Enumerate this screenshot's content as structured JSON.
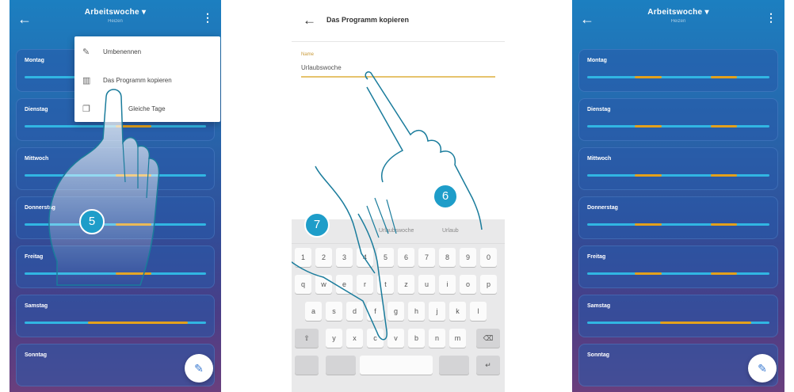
{
  "colors": {
    "accent": "#1e9dc9",
    "bar": "#31b6e3",
    "segment": "#e3a11c"
  },
  "phone1": {
    "appbar": {
      "title": "Arbeitswoche ▾",
      "subtitle": "Heizen"
    },
    "menu": [
      {
        "icon": "pencil-icon",
        "label": "Umbenennen"
      },
      {
        "icon": "copy-program-icon",
        "label": "Das Programm kopieren"
      },
      {
        "icon": "copy-days-icon",
        "label": "Gleiche Tage"
      }
    ],
    "days": [
      "Montag",
      "Dienstag",
      "Mittwoch",
      "Donnerstag",
      "Freitag",
      "Samstag",
      "Sonntag"
    ],
    "step": "5"
  },
  "phone2": {
    "title": "Das Programm kopieren",
    "field_label": "Name",
    "field_value": "Urlaubswoche",
    "suggestions": [
      "Urlaubswoche",
      "Urlaub"
    ],
    "number_row": [
      "1",
      "2",
      "3",
      "4",
      "5",
      "6",
      "7",
      "8",
      "9",
      "0"
    ],
    "row1": [
      "q",
      "w",
      "e",
      "r",
      "t",
      "z",
      "u",
      "i",
      "o",
      "p"
    ],
    "row2": [
      "a",
      "s",
      "d",
      "f",
      "g",
      "h",
      "j",
      "k",
      "l"
    ],
    "row3": [
      "y",
      "x",
      "c",
      "v",
      "b",
      "n",
      "m"
    ],
    "steps": [
      "6",
      "7"
    ]
  },
  "phone3": {
    "appbar": {
      "title": "Arbeitswoche ▾",
      "subtitle": "Heizen"
    },
    "days": [
      "Montag",
      "Dienstag",
      "Mittwoch",
      "Donnerstag",
      "Freitag",
      "Samstag",
      "Sonntag"
    ]
  }
}
